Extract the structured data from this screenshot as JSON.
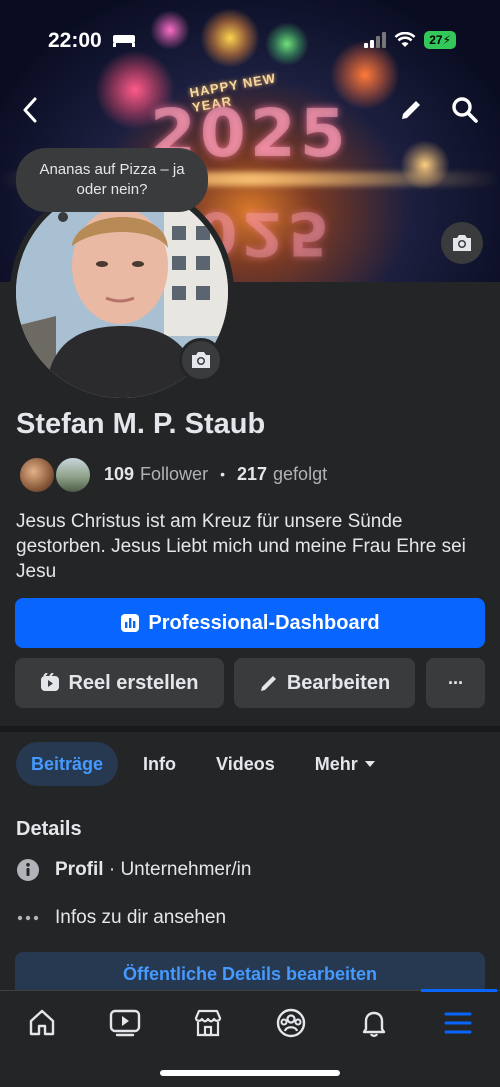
{
  "status_bar": {
    "time": "22:00",
    "battery": "27"
  },
  "cover": {
    "happy_text": "HAPPY NEW YEAR",
    "year_text": "2025",
    "year_text_reflection": "2025"
  },
  "header": {
    "back_icon": "chevron-left-icon",
    "edit_icon": "pencil-icon",
    "search_icon": "search-icon"
  },
  "note_bubble": {
    "text": "Ananas auf Pizza – ja oder nein?"
  },
  "profile": {
    "name": "Stefan M. P. Staub",
    "followers_count": "109",
    "followers_label": "Follower",
    "separator": "•",
    "following_count": "217",
    "following_label": "gefolgt",
    "bio": "Jesus Christus ist am Kreuz für unsere Sünde gestorben. Jesus Liebt mich und meine Frau Ehre sei Jesu"
  },
  "actions": {
    "dashboard_label": "Professional-Dashboard",
    "reel_label": "Reel erstellen",
    "edit_label": "Bearbeiten",
    "more_label": "···"
  },
  "tabs": [
    {
      "label": "Beiträge",
      "active": true
    },
    {
      "label": "Info",
      "active": false
    },
    {
      "label": "Videos",
      "active": false
    },
    {
      "label": "Mehr",
      "active": false
    }
  ],
  "details": {
    "title": "Details",
    "profile_bold": "Profil",
    "profile_rest": " · Unternehmer/in",
    "infos_label": "Infos zu dir ansehen",
    "public_button": "Öffentliche Details bearbeiten"
  },
  "bottom_nav": [
    {
      "icon": "home-icon"
    },
    {
      "icon": "video-icon"
    },
    {
      "icon": "marketplace-icon"
    },
    {
      "icon": "groups-icon"
    },
    {
      "icon": "bell-icon"
    },
    {
      "icon": "menu-icon",
      "active": true
    }
  ],
  "colors": {
    "accent": "#0866ff",
    "background": "#242526",
    "surface": "#3a3b3c",
    "accent_text": "#4599ff"
  }
}
